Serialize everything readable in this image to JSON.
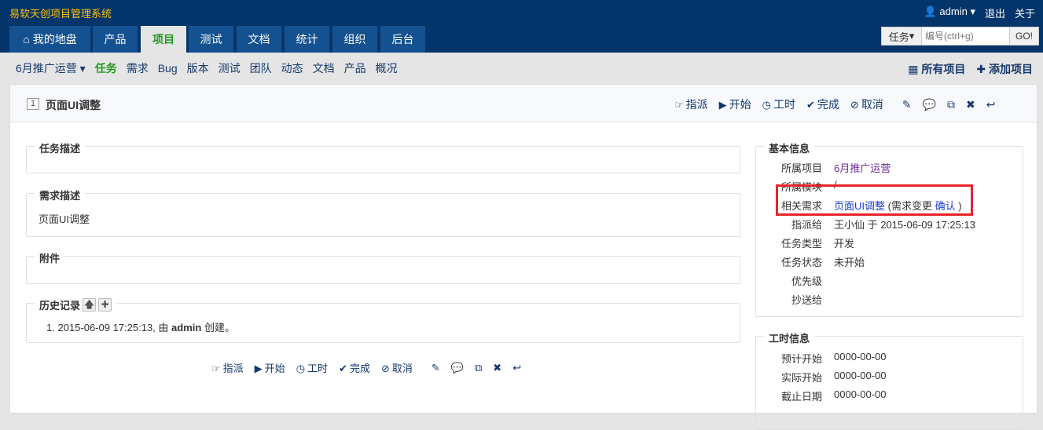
{
  "app": {
    "title": "易软天创项目管理系统",
    "user": "admin",
    "logout": "退出",
    "about": "关于"
  },
  "tabs": [
    {
      "label": "我的地盘"
    },
    {
      "label": "产品"
    },
    {
      "label": "项目"
    },
    {
      "label": "测试"
    },
    {
      "label": "文档"
    },
    {
      "label": "统计"
    },
    {
      "label": "组织"
    },
    {
      "label": "后台"
    }
  ],
  "search": {
    "type": "任务",
    "placeholder": "编号(ctrl+g)",
    "go": "GO!"
  },
  "subnav": {
    "project": "6月推广运营",
    "items": [
      "任务",
      "需求",
      "Bug",
      "版本",
      "测试",
      "团队",
      "动态",
      "文档",
      "产品",
      "概况"
    ],
    "all": "所有项目",
    "add": "添加项目"
  },
  "task": {
    "id": "1",
    "title": "页面UI调整"
  },
  "actions": {
    "assign": "指派",
    "start": "开始",
    "hours": "工时",
    "finish": "完成",
    "cancel": "取消"
  },
  "sections": {
    "desc": "任务描述",
    "story": "需求描述",
    "story_text": "页面UI调整",
    "files": "附件",
    "history": "历史记录"
  },
  "history": [
    {
      "num": "1.",
      "time": "2015-06-09 17:25:13, 由",
      "user": "admin",
      "action": "创建。"
    }
  ],
  "basic": {
    "title": "基本信息",
    "rows": [
      {
        "k": "所属项目",
        "v": "6月推广运营"
      },
      {
        "k": "所属模块",
        "v": "/"
      },
      {
        "k": "相关需求",
        "v": "页面UI调整",
        "extra": "(需求变更",
        "confirm": "确认",
        "end": ")"
      },
      {
        "k": "指派给",
        "v": "王小仙 于 2015-06-09 17:25:13"
      },
      {
        "k": "任务类型",
        "v": "开发"
      },
      {
        "k": "任务状态",
        "v": "未开始"
      },
      {
        "k": "优先级",
        "v": ""
      },
      {
        "k": "抄送给",
        "v": ""
      }
    ]
  },
  "effort": {
    "title": "工时信息",
    "rows": [
      {
        "k": "预计开始",
        "v": "0000-00-00"
      },
      {
        "k": "实际开始",
        "v": "0000-00-00"
      },
      {
        "k": "截止日期",
        "v": "0000-00-00"
      }
    ]
  },
  "colors": {
    "topbar": "#04356a",
    "tab": "#145190",
    "brand": "#ffc000",
    "active": "#229a1f",
    "highlight": "#e8232a"
  }
}
